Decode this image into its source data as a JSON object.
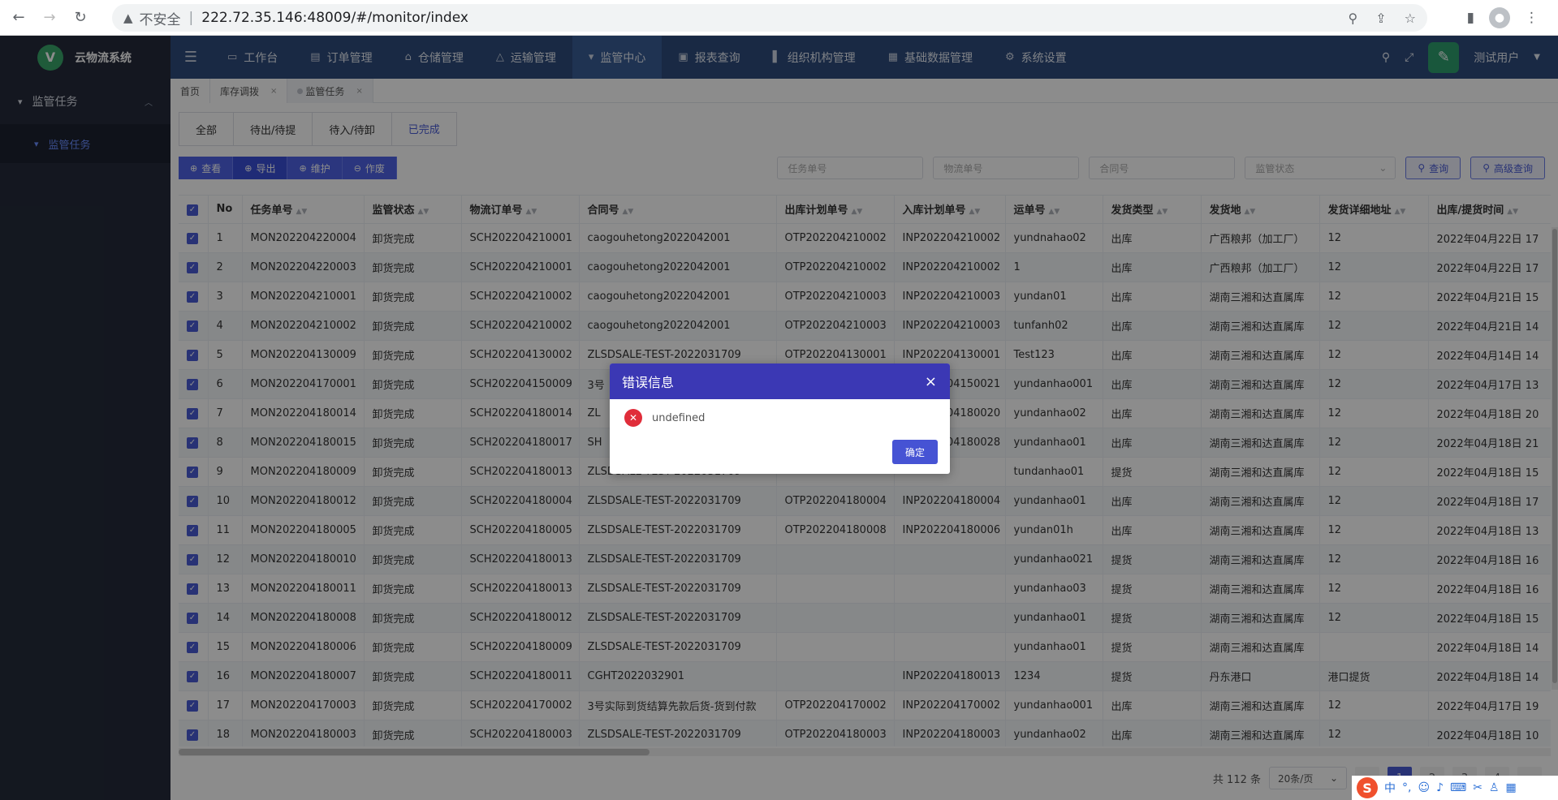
{
  "browser": {
    "insecure_label": "不安全",
    "url": "222.72.35.146:48009/#/monitor/index"
  },
  "app": {
    "title": "云物流系统",
    "logo_letter": "V",
    "nav": [
      {
        "label": "工作台",
        "icon": "desktop-icon"
      },
      {
        "label": "订单管理",
        "icon": "document-icon"
      },
      {
        "label": "仓储管理",
        "icon": "warehouse-icon"
      },
      {
        "label": "运输管理",
        "icon": "transport-icon"
      },
      {
        "label": "监管中心",
        "icon": "monitor-icon"
      },
      {
        "label": "报表查询",
        "icon": "report-icon"
      },
      {
        "label": "组织机构管理",
        "icon": "org-icon"
      },
      {
        "label": "基础数据管理",
        "icon": "data-icon"
      },
      {
        "label": "系统设置",
        "icon": "gear-icon"
      }
    ],
    "user": "测试用户"
  },
  "sidebar": {
    "group": "监管任务",
    "item": "监管任务"
  },
  "page_tabs": [
    {
      "label": "首页"
    },
    {
      "label": "库存调拨"
    },
    {
      "label": "监管任务"
    }
  ],
  "status_tabs": [
    "全部",
    "待出/待提",
    "待入/待卸",
    "已完成"
  ],
  "toolbar": {
    "view": "查看",
    "export": "导出",
    "maintain": "维护",
    "void": "作废"
  },
  "filters": {
    "task_no": "任务单号",
    "logistics_no": "物流单号",
    "contract_no": "合同号",
    "status": "监管状态",
    "query": "查询",
    "advanced_query": "高级查询"
  },
  "table": {
    "columns": [
      "No",
      "任务单号",
      "监管状态",
      "物流订单号",
      "合同号",
      "出库计划单号",
      "入库计划单号",
      "运单号",
      "发货类型",
      "发货地",
      "发货详细地址",
      "出库/提货时间"
    ],
    "rows": [
      [
        "1",
        "MON202204220004",
        "卸货完成",
        "SCH202204210001",
        "caogouhetong2022042001",
        "OTP202204210002",
        "INP202204210002",
        "yundnahao02",
        "出库",
        "广西粮邦（加工厂）",
        "12",
        "2022年04月22日 17"
      ],
      [
        "2",
        "MON202204220003",
        "卸货完成",
        "SCH202204210001",
        "caogouhetong2022042001",
        "OTP202204210002",
        "INP202204210002",
        "1",
        "出库",
        "广西粮邦（加工厂）",
        "12",
        "2022年04月22日 17"
      ],
      [
        "3",
        "MON202204210001",
        "卸货完成",
        "SCH202204210002",
        "caogouhetong2022042001",
        "OTP202204210003",
        "INP202204210003",
        "yundan01",
        "出库",
        "湖南三湘和达直属库",
        "12",
        "2022年04月21日 15"
      ],
      [
        "4",
        "MON202204210002",
        "卸货完成",
        "SCH202204210002",
        "caogouhetong2022042001",
        "OTP202204210003",
        "INP202204210003",
        "tunfanh02",
        "出库",
        "湖南三湘和达直属库",
        "12",
        "2022年04月21日 14"
      ],
      [
        "5",
        "MON202204130009",
        "卸货完成",
        "SCH202204130002",
        "ZLSDSALE-TEST-2022031709",
        "OTP202204130001",
        "INP202204130001",
        "Test123",
        "出库",
        "湖南三湘和达直属库",
        "12",
        "2022年04月14日 14"
      ],
      [
        "6",
        "MON202204170001",
        "卸货完成",
        "SCH202204150009",
        "3号",
        "",
        "INP202204150021",
        "yundanhao001",
        "出库",
        "湖南三湘和达直属库",
        "12",
        "2022年04月17日 13"
      ],
      [
        "7",
        "MON202204180014",
        "卸货完成",
        "SCH202204180014",
        "ZL",
        "",
        "INP202204180020",
        "yundanhao02",
        "出库",
        "湖南三湘和达直属库",
        "12",
        "2022年04月18日 20"
      ],
      [
        "8",
        "MON202204180015",
        "卸货完成",
        "SCH202204180017",
        "SH",
        "",
        "INP202204180028",
        "yundanhao01",
        "出库",
        "湖南三湘和达直属库",
        "12",
        "2022年04月18日 21"
      ],
      [
        "9",
        "MON202204180009",
        "卸货完成",
        "SCH202204180013",
        "ZLSDSALE-TEST-2022031709",
        "",
        "",
        "tundanhao01",
        "提货",
        "湖南三湘和达直属库",
        "12",
        "2022年04月18日 15"
      ],
      [
        "10",
        "MON202204180012",
        "卸货完成",
        "SCH202204180004",
        "ZLSDSALE-TEST-2022031709",
        "OTP202204180004",
        "INP202204180004",
        "yundanhao01",
        "出库",
        "湖南三湘和达直属库",
        "12",
        "2022年04月18日 17"
      ],
      [
        "11",
        "MON202204180005",
        "卸货完成",
        "SCH202204180005",
        "ZLSDSALE-TEST-2022031709",
        "OTP202204180008",
        "INP202204180006",
        "yundan01h",
        "出库",
        "湖南三湘和达直属库",
        "12",
        "2022年04月18日 13"
      ],
      [
        "12",
        "MON202204180010",
        "卸货完成",
        "SCH202204180013",
        "ZLSDSALE-TEST-2022031709",
        "",
        "",
        "yundanhao021",
        "提货",
        "湖南三湘和达直属库",
        "12",
        "2022年04月18日 16"
      ],
      [
        "13",
        "MON202204180011",
        "卸货完成",
        "SCH202204180013",
        "ZLSDSALE-TEST-2022031709",
        "",
        "",
        "yundanhao03",
        "提货",
        "湖南三湘和达直属库",
        "12",
        "2022年04月18日 16"
      ],
      [
        "14",
        "MON202204180008",
        "卸货完成",
        "SCH202204180012",
        "ZLSDSALE-TEST-2022031709",
        "",
        "",
        "yundanhao01",
        "提货",
        "湖南三湘和达直属库",
        "12",
        "2022年04月18日 15"
      ],
      [
        "15",
        "MON202204180006",
        "卸货完成",
        "SCH202204180009",
        "ZLSDSALE-TEST-2022031709",
        "",
        "",
        "yundanhao01",
        "提货",
        "湖南三湘和达直属库",
        "",
        "2022年04月18日 14"
      ],
      [
        "16",
        "MON202204180007",
        "卸货完成",
        "SCH202204180011",
        "CGHT2022032901",
        "",
        "INP202204180013",
        "1234",
        "提货",
        "丹东港口",
        "港口提货",
        "2022年04月18日 14"
      ],
      [
        "17",
        "MON202204170003",
        "卸货完成",
        "SCH202204170002",
        "3号实际到货结算先款后货-货到付款",
        "OTP202204170002",
        "INP202204170002",
        "yundanhao001",
        "出库",
        "湖南三湘和达直属库",
        "12",
        "2022年04月17日 19"
      ],
      [
        "18",
        "MON202204180003",
        "卸货完成",
        "SCH202204180003",
        "ZLSDSALE-TEST-2022031709",
        "OTP202204180003",
        "INP202204180003",
        "yundanhao02",
        "出库",
        "湖南三湘和达直属库",
        "12",
        "2022年04月18日 10"
      ]
    ]
  },
  "pagination": {
    "total": "共 112 条",
    "page_size": "20条/页",
    "pages": [
      "1",
      "2",
      "3",
      "4"
    ],
    "current": "1"
  },
  "dialog": {
    "title": "错误信息",
    "message": "undefined",
    "ok": "确定"
  },
  "ime": {
    "logo": "S",
    "mode": "中"
  }
}
